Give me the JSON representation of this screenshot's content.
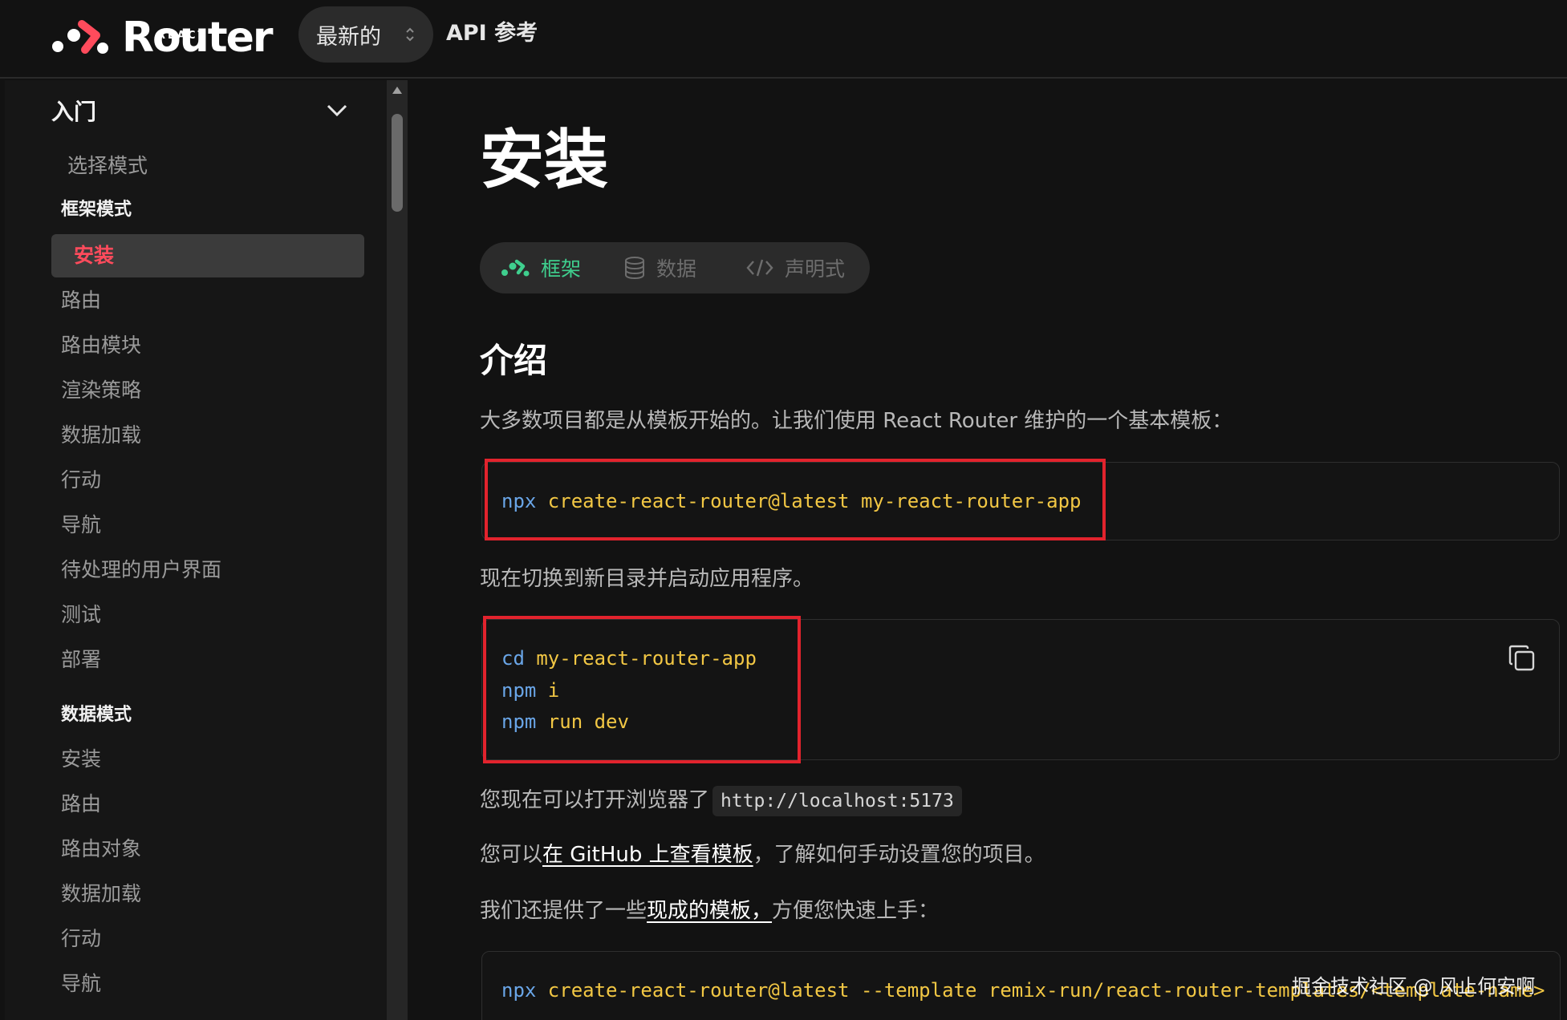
{
  "header": {
    "logo_superscript": "REACT",
    "logo_word": "Router",
    "version_label": "最新的",
    "api_link": "API 参考"
  },
  "sidebar": {
    "section_title": "入门",
    "items": [
      {
        "label": "选择模式"
      }
    ],
    "framework_section": "框架模式",
    "framework_items": [
      {
        "label": "安装",
        "active": true
      },
      {
        "label": "路由"
      },
      {
        "label": "路由模块"
      },
      {
        "label": "渲染策略"
      },
      {
        "label": "数据加载"
      },
      {
        "label": "行动"
      },
      {
        "label": "导航"
      },
      {
        "label": "待处理的用户界面"
      },
      {
        "label": "测试"
      },
      {
        "label": "部署"
      }
    ],
    "data_section": "数据模式",
    "data_items": [
      {
        "label": "安装"
      },
      {
        "label": "路由"
      },
      {
        "label": "路由对象"
      },
      {
        "label": "数据加载"
      },
      {
        "label": "行动"
      },
      {
        "label": "导航"
      }
    ]
  },
  "main": {
    "title": "安装",
    "mode_tabs": [
      {
        "label": "框架",
        "icon": "framework-icon",
        "active": true
      },
      {
        "label": "数据",
        "icon": "database-icon"
      },
      {
        "label": "声明式",
        "icon": "code-brackets-icon"
      }
    ],
    "intro_heading": "介绍",
    "intro_text": "大多数项目都是从模板开始的。让我们使用 React Router 维护的一个基本模板：",
    "code1": {
      "cmd": "npx",
      "args": " create-react-router@latest my-react-router-app"
    },
    "switch_text": "现在切换到新目录并启动应用程序。",
    "code2": [
      {
        "cmd": "cd",
        "args": " my-react-router-app"
      },
      {
        "cmd": "npm",
        "args": " i"
      },
      {
        "cmd": "npm",
        "args": " run dev"
      }
    ],
    "browser_text": "您现在可以打开浏览器了",
    "localhost": "http://localhost:5173",
    "github_prefix": "您可以",
    "github_link": "在 GitHub 上查看模板",
    "github_suffix": "，了解如何手动设置您的项目。",
    "templates_prefix": "我们还提供了一些",
    "templates_link": "现成的模板，",
    "templates_suffix": "方便您快速上手：",
    "code3": {
      "cmd": "npx",
      "args": " create-react-router@latest --template remix-run/react-router-templates/<template-name>"
    }
  },
  "watermark": "掘金技术社区 @ 风止何安啊",
  "colors": {
    "accent_red": "#ff4b5c",
    "accent_green": "#3fcf8e",
    "highlight_border": "#e2232d",
    "code_command": "#6aa6e8",
    "code_argument": "#f2c744"
  }
}
